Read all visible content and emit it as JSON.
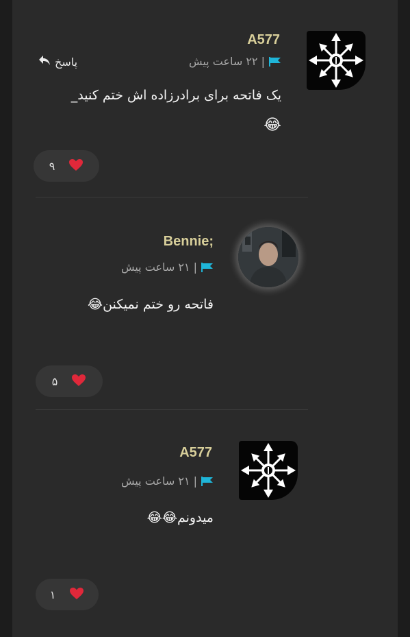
{
  "comments": [
    {
      "username": "A577",
      "time": "| ۲۲ ساعت پیش",
      "reply_label": "پاسخ",
      "text_line1": "یک فاتحه برای برادرزاده اش ختم کنید_",
      "text_line2": "😂",
      "likes": "۹",
      "avatar": "chaos-star-emblem"
    },
    {
      "username": "Bennie;",
      "time": "| ۲۱ ساعت پیش",
      "text": "فاتحه رو ختم نمیکنن😂",
      "likes": "۵",
      "avatar": "portrait-photo"
    },
    {
      "username": "A577",
      "time": "| ۲۱ ساعت پیش",
      "text": "میدونم😂😂",
      "likes": "۱",
      "avatar": "chaos-star-emblem"
    }
  ],
  "colors": {
    "background": "#1c1c1c",
    "panel": "#2a2a2a",
    "username": "#d8cf9a",
    "flag": "#1fb5d8",
    "heart": "#e0283a"
  }
}
